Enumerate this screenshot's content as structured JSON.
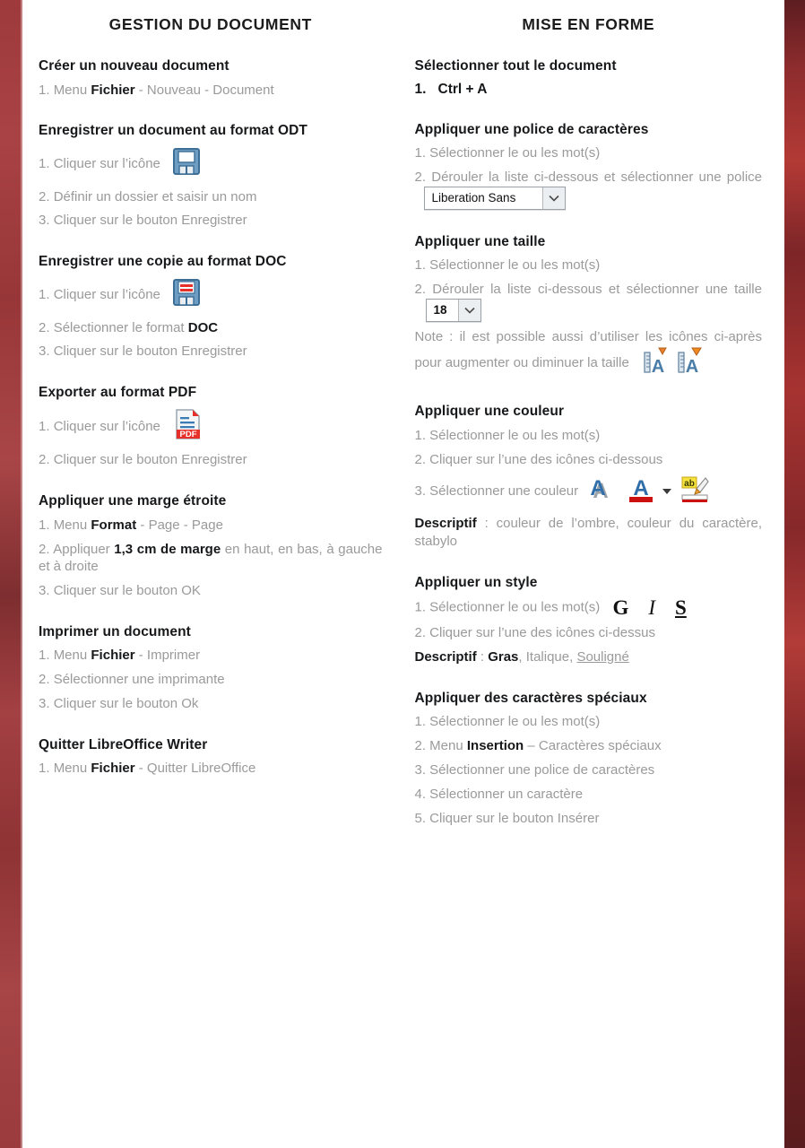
{
  "colors": {
    "band_left": "#a33f3f",
    "band_right": "#8e2c2e",
    "heading": "#17181a",
    "body": "#9a9a9a"
  },
  "left_column": {
    "title": "GESTION DU DOCUMENT",
    "blocks": [
      {
        "heading": "Créer un nouveau document",
        "steps": [
          {
            "num": "1. ",
            "pre": "Menu ",
            "bold": "Fichier",
            "post": " - Nouveau - Document"
          }
        ]
      },
      {
        "heading": "Enregistrer un document au format ODT",
        "steps": [
          {
            "num": "1. ",
            "pre": "Cliquer sur l’icône",
            "icon": "save-floppy-icon"
          },
          {
            "num": "2. ",
            "pre": "Définir un dossier et saisir un nom"
          },
          {
            "num": "3. ",
            "pre": "Cliquer sur le bouton Enregistrer"
          }
        ]
      },
      {
        "heading": "Enregistrer une copie au format DOC",
        "steps": [
          {
            "num": "1. ",
            "pre": "Cliquer sur l’icône",
            "icon": "save-as-icon"
          },
          {
            "num": "2. ",
            "pre": "Sélectionner le format ",
            "bold": "DOC"
          },
          {
            "num": "3. ",
            "pre": "Cliquer sur le bouton Enregistrer"
          }
        ]
      },
      {
        "heading": "Exporter au format PDF",
        "steps": [
          {
            "num": "1. ",
            "pre": "Cliquer sur l’icône",
            "icon": "export-pdf-icon"
          },
          {
            "num": "2. ",
            "pre": "Cliquer sur le bouton Enregistrer"
          }
        ]
      },
      {
        "heading": "Appliquer une marge étroite",
        "steps": [
          {
            "num": "1. ",
            "pre": "Menu ",
            "bold": "Format",
            "post": " - Page - Page"
          },
          {
            "num": "2. ",
            "pre": "Appliquer ",
            "bold": "1,3 cm de marge",
            "post": " en haut, en bas, à gauche et à droite"
          },
          {
            "num": "3. ",
            "pre": "Cliquer sur le bouton OK"
          }
        ]
      },
      {
        "heading": "Imprimer un document",
        "steps": [
          {
            "num": "1. ",
            "pre": "Menu ",
            "bold": "Fichier",
            "post": " - Imprimer"
          },
          {
            "num": "2. ",
            "pre": " Sélectionner une imprimante"
          },
          {
            "num": "3. ",
            "pre": "Cliquer sur le bouton Ok"
          }
        ]
      },
      {
        "heading": "Quitter LibreOffice Writer",
        "steps": [
          {
            "num": "1. ",
            "pre": "Menu ",
            "bold": "Fichier",
            "post": " - Quitter LibreOffice"
          }
        ]
      }
    ]
  },
  "right_column": {
    "title": "MISE EN FORME",
    "select_all": {
      "heading": "Sélectionner tout le document",
      "step_num": "1.",
      "shortcut": "Ctrl + A"
    },
    "font_family": {
      "heading": "Appliquer une police de caractères",
      "step1": "1. Sélectionner le ou les mot(s)",
      "step2_pre": "2.  Dérouler  la  liste  ci-dessous  et sélectionner une police",
      "combo_value": "Liberation Sans"
    },
    "font_size": {
      "heading": "Appliquer une taille",
      "step1": "1. Sélectionner le ou les mot(s)",
      "step2_pre": "2.  Dérouler  la  liste  ci-dessous  et sélectionner une taille",
      "combo_value": "18",
      "note": "Note : il est possible aussi d’utiliser les icônes  ci-après  pour  augmenter  ou diminuer la taille",
      "icon_increase": "increase-font-size-icon",
      "icon_decrease": "decrease-font-size-icon"
    },
    "color": {
      "heading": "Appliquer une couleur",
      "step1": "1. Sélectionner le ou les mot(s)",
      "step2": "2. Cliquer sur l’une des icônes ci-dessous",
      "step3": "3. Sélectionner une couleur",
      "icons": [
        "shadow-color-icon",
        "font-color-icon",
        "dropdown-arrow-icon",
        "highlight-icon"
      ],
      "descriptif_label": "Descriptif",
      "descriptif_text": " : couleur de l’ombre, couleur du caractère, stabylo"
    },
    "style": {
      "heading": "Appliquer un style",
      "step1": "1. Sélectionner le ou les mot(s)",
      "glyph_bold": "G",
      "glyph_italic": "I",
      "glyph_underline": "S",
      "step2": "2. Cliquer sur l’une des icônes ci-dessus",
      "descriptif_label": "Descriptif",
      "descriptif_sep": " : ",
      "descriptif_bold": "Gras",
      "descriptif_mid": ", Italique, ",
      "descriptif_underline": "Souligné"
    },
    "special_chars": {
      "heading": "Appliquer des caractères spéciaux",
      "steps": [
        {
          "pre": "1. Sélectionner le ou les mot(s)"
        },
        {
          "pre": "2. Menu ",
          "bold": "Insertion",
          "post": " – Caractères spéciaux"
        },
        {
          "pre": "3. Sélectionner une police de caractères"
        },
        {
          "pre": "4. Sélectionner un caractère"
        },
        {
          "pre": "5. Cliquer sur le bouton Insérer"
        }
      ]
    }
  }
}
